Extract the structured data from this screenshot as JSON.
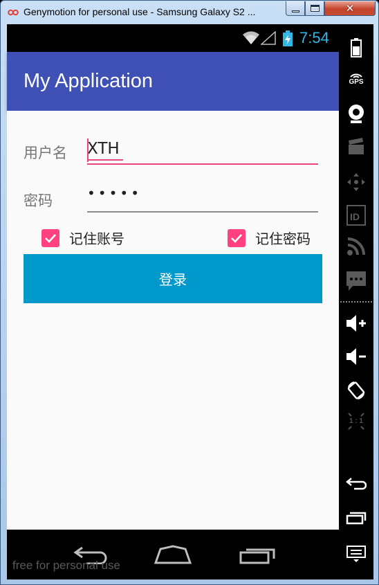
{
  "window": {
    "title": "Genymotion for personal use - Samsung Galaxy S2 ...",
    "icon": "genymotion-logo-icon"
  },
  "status_bar": {
    "time": "7:54",
    "icons": [
      "wifi-icon",
      "signal-icon",
      "battery-charging-icon"
    ]
  },
  "app_bar": {
    "title": "My Application"
  },
  "form": {
    "username_label": "用户名",
    "username_value": "XTH",
    "password_label": "密码",
    "password_value": "•••••",
    "remember_account_label": "记住账号",
    "remember_account_checked": true,
    "remember_password_label": "记住密码",
    "remember_password_checked": true,
    "login_button": "登录"
  },
  "colors": {
    "app_bar": "#3f51b5",
    "accent": "#ff4081",
    "button": "#0099cc",
    "clock": "#33b5e5"
  },
  "nav_bar": {
    "buttons": [
      "back-icon",
      "home-icon",
      "recent-apps-icon"
    ],
    "watermark": "free for personal use"
  },
  "sidebar": {
    "gps_label": "GPS",
    "ratio_label": "1 : 1",
    "icons": [
      "battery-icon",
      "gps-icon",
      "camera-icon",
      "video-capture-icon",
      "dpad-icon",
      "identifier-icon",
      "rss-icon",
      "sms-icon",
      "volume-up-icon",
      "volume-down-icon",
      "rotate-icon",
      "pixel-ratio-icon",
      "back-icon",
      "recent-apps-icon",
      "menu-icon"
    ]
  }
}
